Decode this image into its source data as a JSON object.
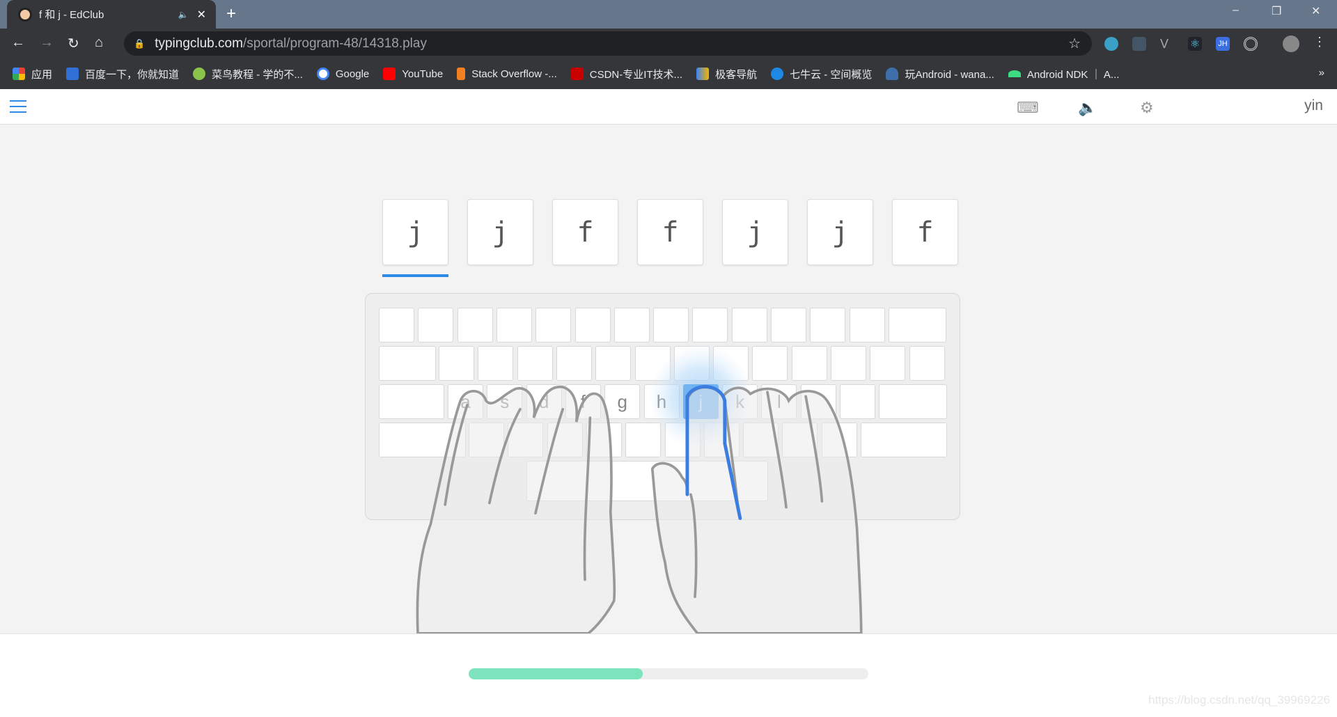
{
  "browser": {
    "tab": {
      "title": "f 和 j - EdClub",
      "audio_icon": "speaker-icon",
      "close": "✕"
    },
    "new_tab": "+",
    "window_controls": [
      "–",
      "❐",
      "✕"
    ],
    "url": {
      "host": "typingclub.com",
      "path": "/sportal/program-48/14318.play"
    },
    "bookmarks": [
      {
        "label": "应用",
        "color": "#e94235"
      },
      {
        "label": "百度一下，你就知道",
        "color": "#2f6fd6"
      },
      {
        "label": "菜鸟教程 - 学的不...",
        "color": "#8bc34a"
      },
      {
        "label": "Google",
        "color": "#ffffff"
      },
      {
        "label": "YouTube",
        "color": "#ff0000"
      },
      {
        "label": "Stack Overflow -...",
        "color": "#f48024"
      },
      {
        "label": "CSDN-专业IT技术...",
        "color": "#c90000"
      },
      {
        "label": "极客导航",
        "color": "#3b82f6"
      },
      {
        "label": "七牛云 - 空间概览",
        "color": "#1e88e5"
      },
      {
        "label": "玩Android - wana...",
        "color": "#3f6ea8"
      },
      {
        "label": "Android NDK ｜ A...",
        "color": "#3ddc84"
      }
    ],
    "bookmarks_more": "»"
  },
  "app": {
    "user": "yin",
    "icons": [
      "menu-icon",
      "keyboard-icon",
      "sound-icon",
      "settings-icon"
    ],
    "letters": [
      "j",
      "j",
      "f",
      "f",
      "j",
      "j",
      "f"
    ],
    "current_index": 0,
    "home_row": [
      "a",
      "s",
      "d",
      "f",
      "g",
      "h",
      "j",
      "k",
      "l"
    ],
    "active_key": "j",
    "progress": 0.436,
    "accent": "#2b8be6",
    "progress_color": "#7de3bd"
  },
  "watermark": "https://blog.csdn.net/qq_39969226"
}
